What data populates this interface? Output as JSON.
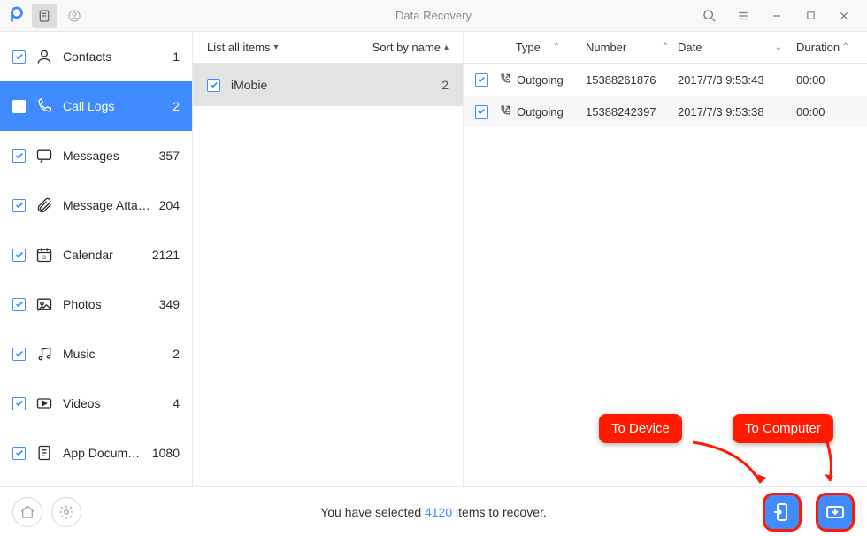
{
  "titlebar": {
    "title": "Data Recovery"
  },
  "sidebar": [
    {
      "label": "Contacts",
      "count": "1",
      "icon": "contact",
      "active": false
    },
    {
      "label": "Call Logs",
      "count": "2",
      "icon": "phone",
      "active": true
    },
    {
      "label": "Messages",
      "count": "357",
      "icon": "message",
      "active": false
    },
    {
      "label": "Message Attach...",
      "count": "204",
      "icon": "attachment",
      "active": false
    },
    {
      "label": "Calendar",
      "count": "2121",
      "icon": "calendar",
      "active": false
    },
    {
      "label": "Photos",
      "count": "349",
      "icon": "photo",
      "active": false
    },
    {
      "label": "Music",
      "count": "2",
      "icon": "music",
      "active": false
    },
    {
      "label": "Videos",
      "count": "4",
      "icon": "video",
      "active": false
    },
    {
      "label": "App Documents",
      "count": "1080",
      "icon": "appdoc",
      "active": false
    }
  ],
  "mid": {
    "list_label": "List all items",
    "sort_label": "Sort by name",
    "rows": [
      {
        "name": "iMobie",
        "count": "2",
        "selected": true
      }
    ]
  },
  "table": {
    "headers": {
      "type": "Type",
      "number": "Number",
      "date": "Date",
      "duration": "Duration"
    },
    "rows": [
      {
        "type": "Outgoing",
        "number": "15388261876",
        "date": "2017/7/3 9:53:43",
        "duration": "00:00"
      },
      {
        "type": "Outgoing",
        "number": "15388242397",
        "date": "2017/7/3 9:53:38",
        "duration": "00:00"
      }
    ]
  },
  "footer": {
    "text_before": "You have selected ",
    "count": "4120",
    "text_after": " items to recover."
  },
  "callouts": {
    "device": "To Device",
    "computer": "To Computer"
  }
}
